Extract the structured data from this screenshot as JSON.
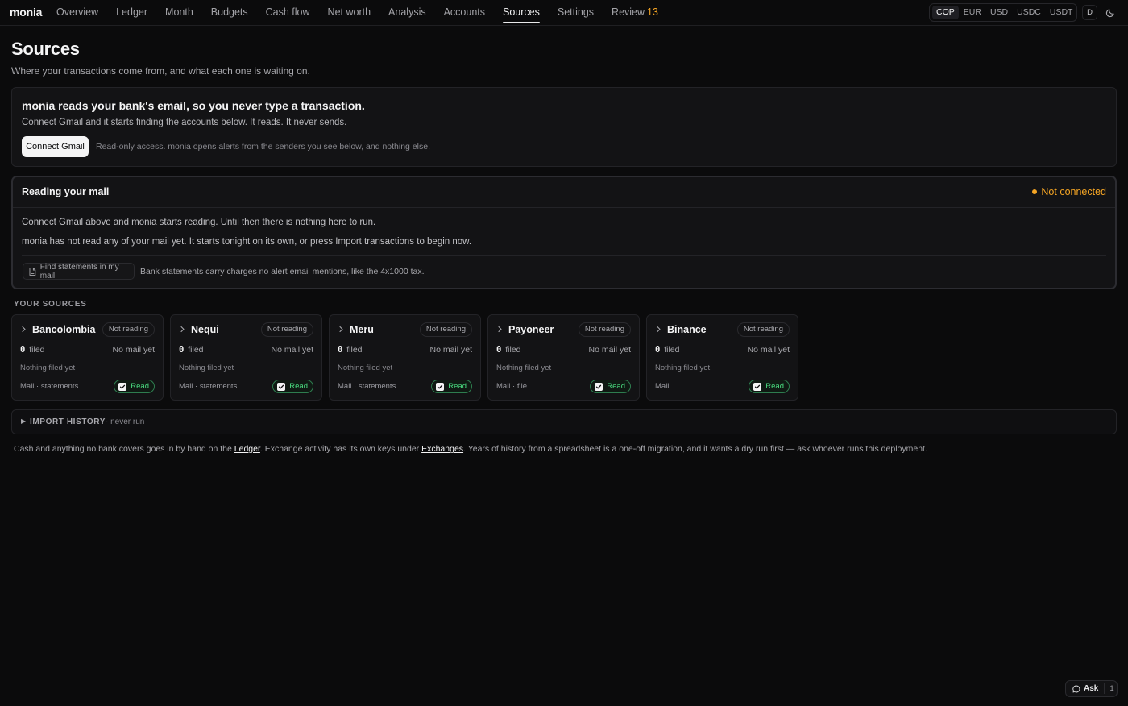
{
  "app": {
    "name": "monia"
  },
  "nav": {
    "items": [
      {
        "label": "Overview",
        "name": "nav-overview"
      },
      {
        "label": "Ledger",
        "name": "nav-ledger"
      },
      {
        "label": "Month",
        "name": "nav-month"
      },
      {
        "label": "Budgets",
        "name": "nav-budgets"
      },
      {
        "label": "Cash flow",
        "name": "nav-cash-flow"
      },
      {
        "label": "Net worth",
        "name": "nav-net-worth"
      },
      {
        "label": "Analysis",
        "name": "nav-analysis"
      },
      {
        "label": "Accounts",
        "name": "nav-accounts"
      },
      {
        "label": "Sources",
        "name": "nav-sources"
      },
      {
        "label": "Settings",
        "name": "nav-settings"
      }
    ],
    "review": {
      "label": "Review",
      "count": "13"
    },
    "active": "Sources"
  },
  "currencies": {
    "items": [
      "COP",
      "EUR",
      "USD",
      "USDC",
      "USDT"
    ],
    "selected": "COP"
  },
  "user": {
    "initial": "D"
  },
  "icons": {
    "theme": "moon-icon",
    "chevron": "chevron-right-icon",
    "check": "check-icon",
    "file": "file-icon",
    "chat": "chat-bubble-icon"
  },
  "colors": {
    "warning": "#f5a524",
    "success": "#4ade80",
    "background": "#0b0b0c"
  },
  "page": {
    "title": "Sources",
    "subtitle": "Where your transactions come from, and what each one is waiting on."
  },
  "hero": {
    "title": "monia reads your bank's email, so you never type a transaction.",
    "text": "Connect Gmail and it starts finding the accounts below. It reads. It never sends.",
    "button": "Connect Gmail",
    "note": "Read-only access. monia opens alerts from the senders you see below, and nothing else."
  },
  "reading": {
    "title": "Reading your mail",
    "status": "Not connected",
    "line1": "Connect Gmail above and monia starts reading. Until then there is nothing here to run.",
    "line2": "monia has not read any of your mail yet. It starts tonight on its own, or press Import transactions to begin now.",
    "find_button": "Find statements in my mail",
    "find_note": "Bank statements carry charges no alert email mentions, like the 4x1000 tax."
  },
  "sources": {
    "heading": "YOUR SOURCES",
    "items": [
      {
        "name": "Bancolombia",
        "badge": "Not reading",
        "filed_count": "0",
        "filed_label": "filed",
        "mail": "No mail yet",
        "nothing": "Nothing filed yet",
        "kind": "Mail · statements",
        "read": "Read"
      },
      {
        "name": "Nequi",
        "badge": "Not reading",
        "filed_count": "0",
        "filed_label": "filed",
        "mail": "No mail yet",
        "nothing": "Nothing filed yet",
        "kind": "Mail · statements",
        "read": "Read"
      },
      {
        "name": "Meru",
        "badge": "Not reading",
        "filed_count": "0",
        "filed_label": "filed",
        "mail": "No mail yet",
        "nothing": "Nothing filed yet",
        "kind": "Mail · statements",
        "read": "Read"
      },
      {
        "name": "Payoneer",
        "badge": "Not reading",
        "filed_count": "0",
        "filed_label": "filed",
        "mail": "No mail yet",
        "nothing": "Nothing filed yet",
        "kind": "Mail · file",
        "read": "Read"
      },
      {
        "name": "Binance",
        "badge": "Not reading",
        "filed_count": "0",
        "filed_label": "filed",
        "mail": "No mail yet",
        "nothing": "Nothing filed yet",
        "kind": "Mail",
        "read": "Read"
      }
    ]
  },
  "history": {
    "arrow": "▶",
    "title": "IMPORT HISTORY",
    "subtitle": "· never run"
  },
  "footer": {
    "part1": "Cash and anything no bank covers goes in by hand on the ",
    "link1": "Ledger",
    "part2": ". Exchange activity has its own keys under ",
    "link2": "Exchanges",
    "part3": ". Years of history from a spreadsheet is a one-off migration, and it wants a dry run first — ask whoever runs this deployment."
  },
  "ask": {
    "label": "Ask",
    "count": "1"
  }
}
